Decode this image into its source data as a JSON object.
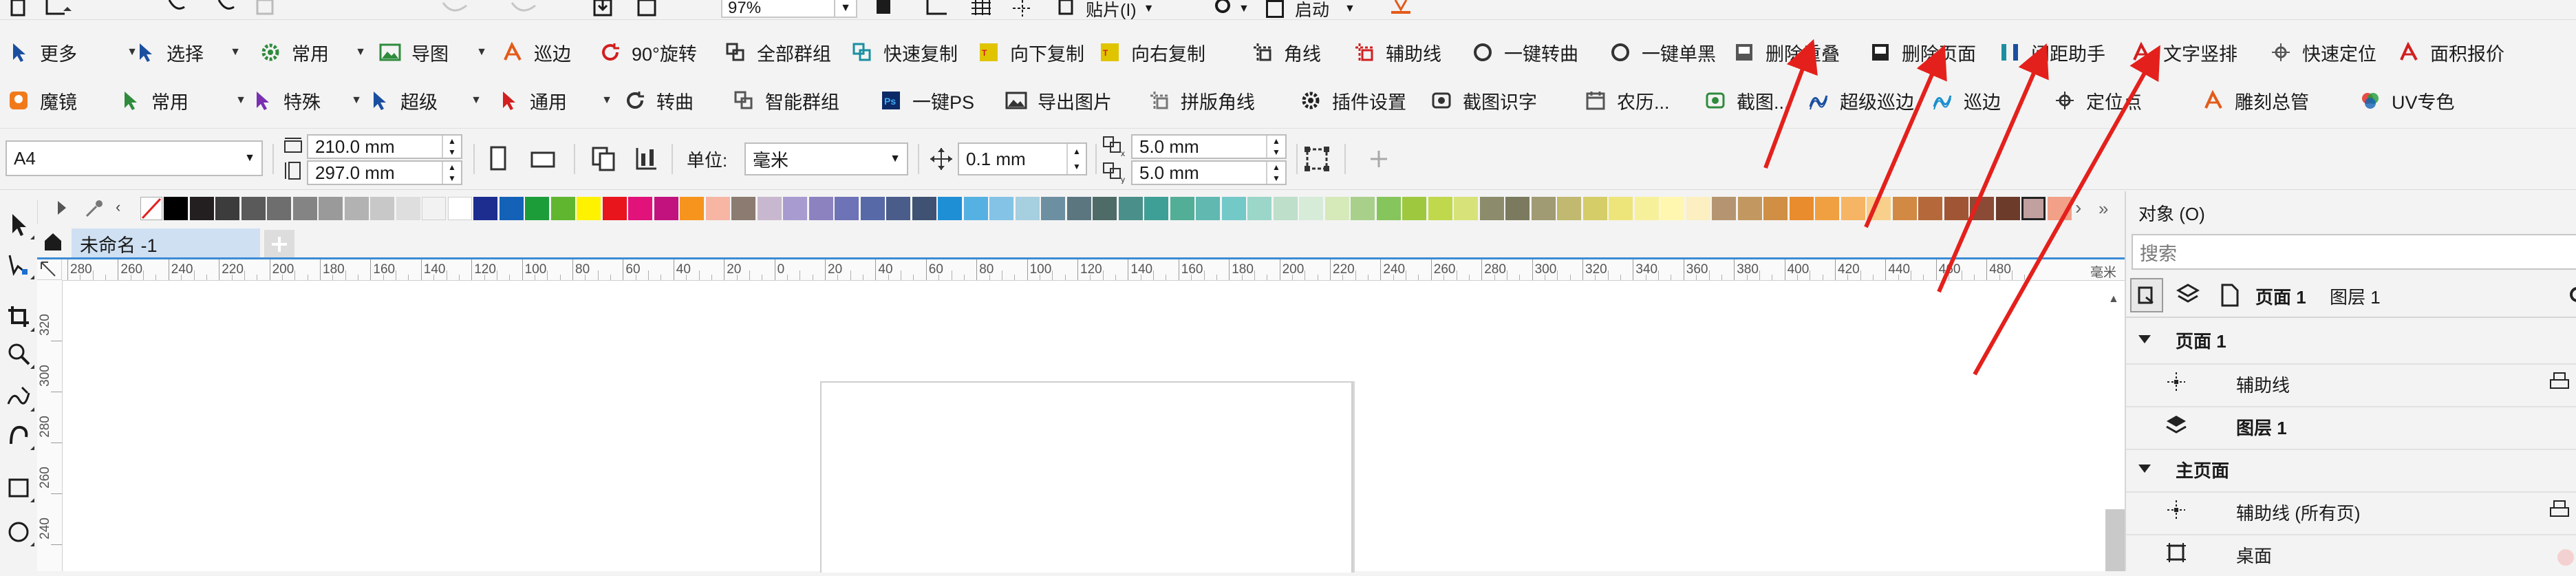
{
  "top_strip": {
    "zoom_value": "97%",
    "paste_label": "贴片(I)",
    "launch_label": "启动"
  },
  "toolbar_row1": [
    {
      "label": "更多",
      "icon": "cursor-icon",
      "color": "#1a4fa0"
    },
    {
      "label": "选择",
      "icon": "select-arrow-icon",
      "color": "#1a4fa0"
    },
    {
      "label": "常用",
      "icon": "gear-icon",
      "color": "#2e8b3c"
    },
    {
      "label": "导图",
      "icon": "image-icon",
      "color": "#2e8b3c"
    },
    {
      "label": "巡边",
      "icon": "trace-border-icon",
      "color": "#e35b1a"
    },
    {
      "label": "90°旋转",
      "icon": "rotate-icon",
      "color": "#d21f1f"
    },
    {
      "label": "全部群组",
      "icon": "group-icon",
      "color": "#333333"
    },
    {
      "label": "快速复制",
      "icon": "quick-copy-icon",
      "color": "#1a8fa0"
    },
    {
      "label": "向下复制",
      "icon": "copy-down-icon",
      "color": "#e0c400"
    },
    {
      "label": "向右复制",
      "icon": "copy-right-icon",
      "color": "#e0c400"
    },
    {
      "label": "角线",
      "icon": "corner-line-icon",
      "color": "#333333"
    },
    {
      "label": "辅助线",
      "icon": "guideline-icon",
      "color": "#d21f1f"
    },
    {
      "label": "一键转曲",
      "icon": "convert-curve-icon",
      "color": "#333333"
    },
    {
      "label": "一键单黑",
      "icon": "single-black-icon",
      "color": "#333333"
    },
    {
      "label": "删除重叠",
      "icon": "delete-overlap-icon",
      "color": "#555555"
    },
    {
      "label": "删除页面",
      "icon": "delete-page-icon",
      "color": "#222222"
    },
    {
      "label": "间距助手",
      "icon": "spacing-icon",
      "color": "#1a8fa0"
    },
    {
      "label": "文字竖排",
      "icon": "vertical-text-icon",
      "color": "#d21f1f"
    },
    {
      "label": "快速定位",
      "icon": "locate-icon",
      "color": "#555555"
    },
    {
      "label": "面积报价",
      "icon": "price-icon",
      "color": "#d21f1f"
    }
  ],
  "toolbar_row2": [
    {
      "label": "魔镜",
      "icon": "magic-mirror-icon",
      "color": "#f07a1a"
    },
    {
      "label": "常用",
      "icon": "green-arrow-icon",
      "color": "#2e8b3c"
    },
    {
      "label": "特殊",
      "icon": "purple-arrow-icon",
      "color": "#7a2fb0"
    },
    {
      "label": "超级",
      "icon": "blue-arrow-icon",
      "color": "#1a4fa0"
    },
    {
      "label": "通用",
      "icon": "red-arrow-icon",
      "color": "#d21f1f"
    },
    {
      "label": "转曲",
      "icon": "curve-icon",
      "color": "#333333"
    },
    {
      "label": "智能群组",
      "icon": "smart-group-icon",
      "color": "#555555"
    },
    {
      "label": "一键PS",
      "icon": "ps-icon",
      "color": "#1a3fa0"
    },
    {
      "label": "导出图片",
      "icon": "export-image-icon",
      "color": "#333333"
    },
    {
      "label": "拼版角线",
      "icon": "imposition-icon",
      "color": "#777777"
    },
    {
      "label": "插件设置",
      "icon": "settings-icon",
      "color": "#222222"
    },
    {
      "label": "截图识字",
      "icon": "ocr-icon",
      "color": "#333333"
    },
    {
      "label": "农历...",
      "icon": "calendar-icon",
      "color": "#555555"
    },
    {
      "label": "截图...",
      "icon": "screenshot-icon",
      "color": "#2e8b3c"
    },
    {
      "label": "超级巡边",
      "icon": "super-trace-icon",
      "color": "#1a4fa0"
    },
    {
      "label": "巡边",
      "icon": "trace-icon",
      "color": "#1a8fd0"
    },
    {
      "label": "定位点",
      "icon": "crosshair-icon",
      "color": "#333333"
    },
    {
      "label": "雕刻总管",
      "icon": "engrave-icon",
      "color": "#e35b1a"
    },
    {
      "label": "UV专色",
      "icon": "uv-color-icon",
      "color": "#7a2fb0"
    }
  ],
  "property_bar": {
    "page_size": "A4",
    "width": "210.0 mm",
    "height": "297.0 mm",
    "unit_label": "单位:",
    "unit_value": "毫米",
    "nudge_value": "0.1 mm",
    "dup_x": "5.0 mm",
    "dup_y": "5.0 mm"
  },
  "palette": [
    "#000000",
    "#231f20",
    "#3c3c3c",
    "#5a5a5a",
    "#6e6e6e",
    "#848484",
    "#9a9a9a",
    "#b2b2b2",
    "#c8c8c8",
    "#dedede",
    "#f2f2f2",
    "#ffffff",
    "#1c2d8f",
    "#1461b8",
    "#1d9d3a",
    "#61b630",
    "#fff200",
    "#e8151c",
    "#e1127a",
    "#c2127e",
    "#f7941d",
    "#f7b5a4",
    "#8b7b71",
    "#c8b8cf",
    "#a89bd0",
    "#8c82c0",
    "#6e72b6",
    "#5869a8",
    "#4a5c8a",
    "#3f5273",
    "#1e8ed5",
    "#56b1e3",
    "#84c3e6",
    "#a6cfe0",
    "#6d8fa2",
    "#5c7680",
    "#4f6b68",
    "#4a8f8a",
    "#3e9f96",
    "#53ae97",
    "#60b8b1",
    "#73c8c8",
    "#9bd6c8",
    "#bedfc9",
    "#d6ebd8",
    "#d5e9b9",
    "#a9d08b",
    "#86c55b",
    "#9ec93e",
    "#c0d84c",
    "#d7e378",
    "#8c8c6c",
    "#7b7a5e",
    "#a09b72",
    "#c0b96f",
    "#d5cd67",
    "#ede57a",
    "#f7f09a",
    "#fff7b0",
    "#fcefc1",
    "#b59571",
    "#c29860",
    "#d08f44",
    "#e88c2e",
    "#f0a040",
    "#f6b564",
    "#f9d08b",
    "#d28943",
    "#b5693b",
    "#a05634",
    "#8a4a35",
    "#6c3b2a",
    "#c2a0a0",
    "#f2a088"
  ],
  "doc_tab": {
    "title": "未命名 -1"
  },
  "ruler": {
    "h_labels": [
      "280",
      "260",
      "240",
      "220",
      "200",
      "180",
      "160",
      "140",
      "120",
      "100",
      "80",
      "60",
      "40",
      "20",
      "0",
      "20",
      "40",
      "60",
      "80",
      "100",
      "120",
      "140",
      "160",
      "180",
      "200",
      "220",
      "240",
      "260",
      "280",
      "300",
      "320",
      "340",
      "360",
      "380",
      "400",
      "420",
      "440",
      "460",
      "480"
    ],
    "unit": "毫米",
    "v_labels": [
      "320",
      "300",
      "280",
      "260",
      "240"
    ]
  },
  "objects_docker": {
    "title": "对象 (O)",
    "search_placeholder": "搜索",
    "breadcrumb_page": "页面 1",
    "breadcrumb_layer": "图层 1",
    "tree": [
      {
        "label": "页面 1",
        "bold": true,
        "level": 0,
        "icon": "collapse-triangle-icon"
      },
      {
        "label": "辅助线",
        "bold": false,
        "level": 1,
        "icon": "guideline-icon"
      },
      {
        "label": "图层 1",
        "bold": true,
        "level": 1,
        "icon": "layers-icon"
      },
      {
        "label": "主页面",
        "bold": true,
        "level": 0,
        "icon": "collapse-triangle-icon"
      },
      {
        "label": "辅助线 (所有页)",
        "bold": false,
        "level": 1,
        "icon": "guideline-icon"
      },
      {
        "label": "桌面",
        "bold": false,
        "level": 1,
        "icon": "desktop-icon"
      }
    ]
  },
  "annotation_arrow_color": "#e4201c"
}
